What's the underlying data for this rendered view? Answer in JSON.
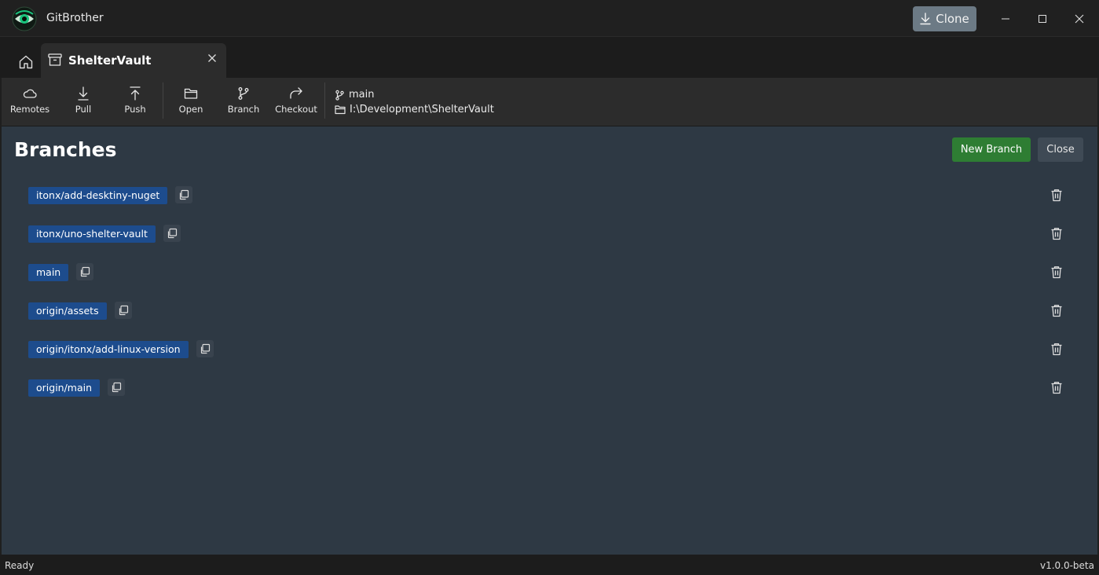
{
  "app": {
    "title": "GitBrother"
  },
  "titlebar": {
    "clone_label": "Clone"
  },
  "tabs": [
    {
      "label": "ShelterVault"
    }
  ],
  "toolbar": {
    "remotes": "Remotes",
    "pull": "Pull",
    "push": "Push",
    "open": "Open",
    "branch": "Branch",
    "checkout": "Checkout"
  },
  "repo": {
    "branch": "main",
    "path": "I:\\Development\\ShelterVault"
  },
  "page": {
    "title": "Branches",
    "new_branch_label": "New Branch",
    "close_label": "Close"
  },
  "branches": [
    {
      "name": "itonx/add-desktiny-nuget"
    },
    {
      "name": "itonx/uno-shelter-vault"
    },
    {
      "name": "main"
    },
    {
      "name": "origin/assets"
    },
    {
      "name": "origin/itonx/add-linux-version"
    },
    {
      "name": "origin/main"
    }
  ],
  "status": {
    "left": "Ready",
    "right": "v1.0.0-beta"
  },
  "colors": {
    "content_bg": "#2e3944",
    "branch_tag": "#1d4c8d",
    "new_branch": "#2e7d33",
    "clone": "#6c7a85"
  },
  "icons": {
    "logo": "eye-logo-icon",
    "clone": "download-icon",
    "home": "home-icon",
    "tab": "archive-box-icon",
    "remotes": "cloud-icon",
    "pull": "arrow-down-icon",
    "push": "arrow-up-icon",
    "open": "folder-icon",
    "branch": "git-branch-icon",
    "checkout": "redo-arrow-icon",
    "copy": "copy-icon",
    "delete": "trash-icon"
  }
}
